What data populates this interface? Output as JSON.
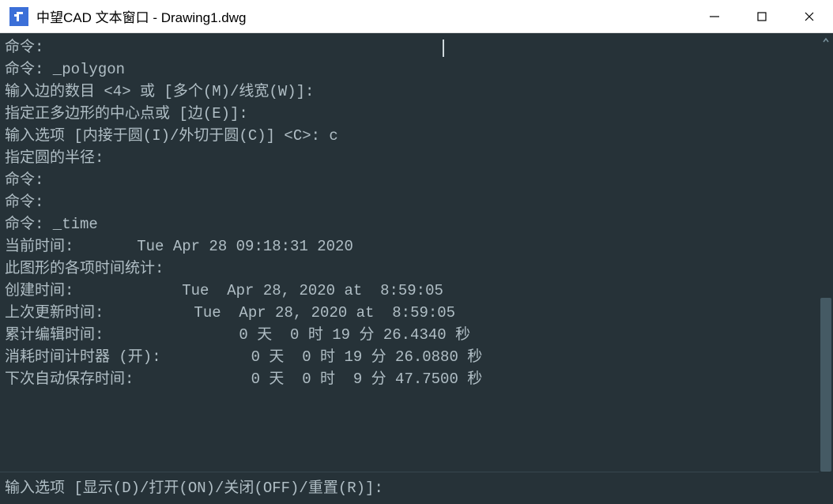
{
  "window": {
    "title": "中望CAD 文本窗口 - Drawing1.dwg"
  },
  "terminal": {
    "lines": [
      "命令:",
      "命令: _polygon",
      "",
      "输入边的数目 <4> 或 [多个(M)/线宽(W)]:",
      "",
      "指定正多边形的中心点或 [边(E)]:",
      "输入选项 [内接于圆(I)/外切于圆(C)] <C>: c",
      "",
      "指定圆的半径:",
      "命令:",
      "命令:",
      "命令: _time",
      "当前时间:       Tue Apr 28 09:18:31 2020",
      "此图形的各项时间统计:",
      "创建时间:            Tue  Apr 28, 2020 at  8:59:05",
      "上次更新时间:          Tue  Apr 28, 2020 at  8:59:05",
      "累计编辑时间:               0 天  0 时 19 分 26.4340 秒",
      "消耗时间计时器 (开):          0 天  0 时 19 分 26.0880 秒",
      "下次自动保存时间:             0 天  0 时  9 分 47.7500 秒"
    ],
    "prompt": "输入选项 [显示(D)/打开(ON)/关闭(OFF)/重置(R)]:"
  }
}
